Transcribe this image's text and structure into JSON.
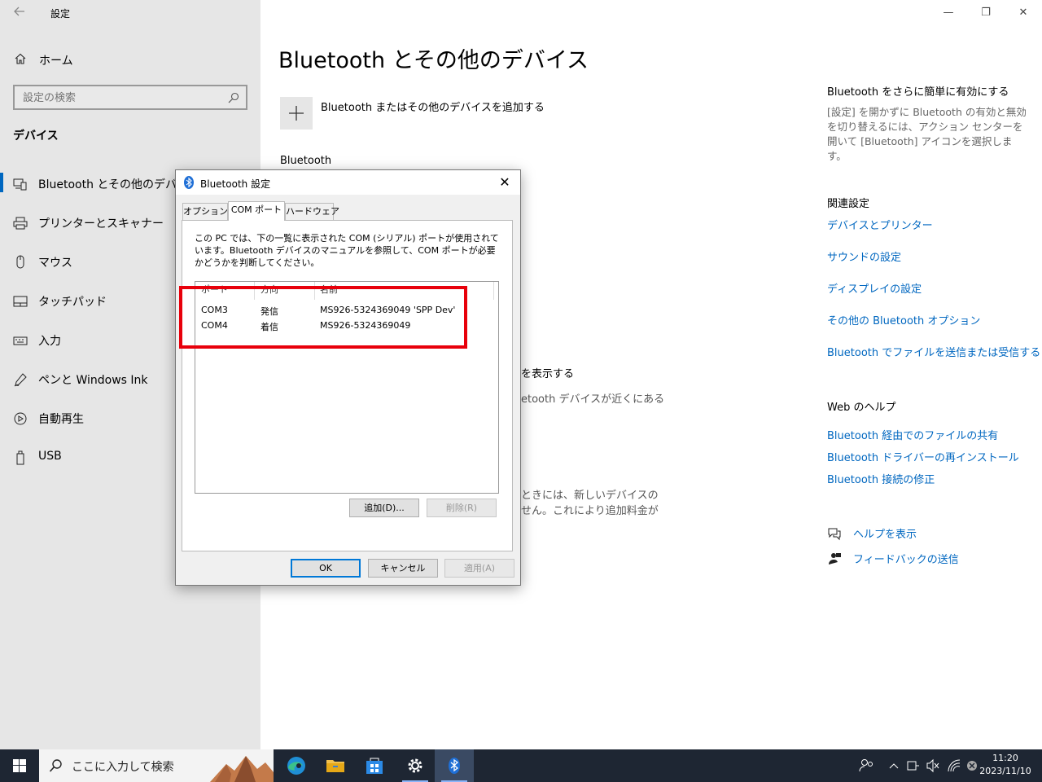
{
  "window": {
    "title": "設定",
    "controls": {
      "minimize": "—",
      "restore": "❐",
      "close": "✕"
    }
  },
  "sidebar": {
    "home_label": "ホーム",
    "search_placeholder": "設定の検索",
    "section_title": "デバイス",
    "items": [
      {
        "label": "Bluetooth とその他のデバイス",
        "icon": "bluetooth-devices-icon",
        "active": true
      },
      {
        "label": "プリンターとスキャナー",
        "icon": "printer-icon",
        "active": false
      },
      {
        "label": "マウス",
        "icon": "mouse-icon",
        "active": false
      },
      {
        "label": "タッチパッド",
        "icon": "touchpad-icon",
        "active": false
      },
      {
        "label": "入力",
        "icon": "keyboard-icon",
        "active": false
      },
      {
        "label": "ペンと Windows Ink",
        "icon": "pen-icon",
        "active": false
      },
      {
        "label": "自動再生",
        "icon": "autoplay-icon",
        "active": false
      },
      {
        "label": "USB",
        "icon": "usb-icon",
        "active": false
      }
    ]
  },
  "main": {
    "title": "Bluetooth とその他のデバイス",
    "add_device_label": "Bluetooth またはその他のデバイスを追加する",
    "bluetooth_heading": "Bluetooth",
    "partial_lines": [
      "を表示する",
      "etooth デバイスが近くにある",
      "ときには、新しいデバイスの",
      "せん。これにより追加料金が"
    ]
  },
  "right_column": {
    "enable_heading": "Bluetooth をさらに簡単に有効にする",
    "enable_desc": "[設定] を開かずに Bluetooth の有効と無効を切り替えるには、アクション センターを開いて [Bluetooth] アイコンを選択します。",
    "related_heading": "関連設定",
    "related_links": [
      "デバイスとプリンター",
      "サウンドの設定",
      "ディスプレイの設定",
      "その他の Bluetooth オプション",
      "Bluetooth でファイルを送信または受信する"
    ],
    "web_help_heading": "Web のヘルプ",
    "web_help_links": [
      "Bluetooth 経由でのファイルの共有",
      "Bluetooth ドライバーの再インストール",
      "Bluetooth 接続の修正"
    ],
    "help_link": "ヘルプを表示",
    "feedback_link": "フィードバックの送信"
  },
  "dialog": {
    "title": "Bluetooth 設定",
    "close": "✕",
    "tabs": [
      "オプション",
      "COM ポート",
      "ハードウェア"
    ],
    "active_tab": 1,
    "description": "この PC では、下の一覧に表示された COM (シリアル) ポートが使用されています。Bluetooth デバイスのマニュアルを参照して、COM ポートが必要かどうかを判断してください。",
    "columns": [
      "ポート",
      "方向",
      "名前"
    ],
    "rows": [
      {
        "port": "COM3",
        "direction": "発信",
        "name": "MS926-5324369049 'SPP Dev'"
      },
      {
        "port": "COM4",
        "direction": "着信",
        "name": "MS926-5324369049"
      }
    ],
    "add_button": "追加(D)...",
    "remove_button": "削除(R)",
    "ok_button": "OK",
    "cancel_button": "キャンセル",
    "apply_button": "適用(A)",
    "highlight_color": "#e8000b"
  },
  "taskbar": {
    "search_placeholder": "ここに入力して検索",
    "apps": [
      "edge-icon",
      "file-explorer-icon",
      "store-icon",
      "settings-icon",
      "bluetooth-icon"
    ],
    "clock_time": "11:20",
    "clock_date": "2023/11/10"
  },
  "colors": {
    "accent": "#0067c0",
    "sidebar_bg": "#e6e6e6",
    "taskbar_bg": "#1e2633"
  }
}
